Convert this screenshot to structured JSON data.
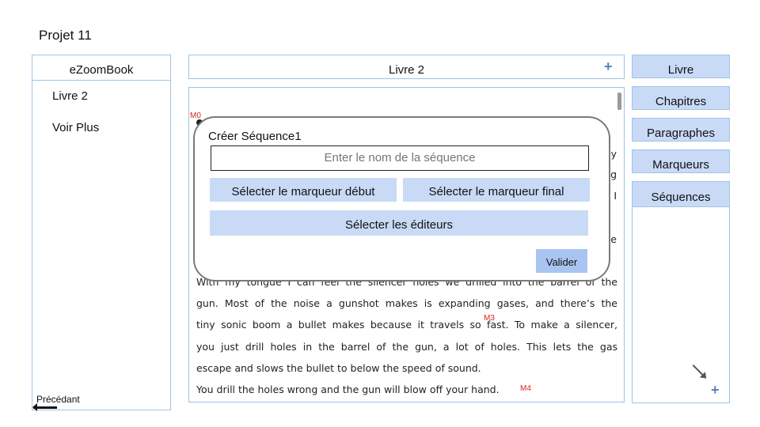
{
  "project_title": "Projet 11",
  "left_panel": {
    "title": "eZoomBook",
    "items": [
      {
        "label": "Livre 2"
      },
      {
        "label": "Voir Plus"
      }
    ],
    "previous_label": "Précédant"
  },
  "center": {
    "header_title": "Livre 2",
    "lines": [
      "With my tongue I can feel the silencer holes we drilled into the barrel of the",
      "gun. Most of the noise a gunshot makes is expanding gases, and there’s the",
      "tiny sonic boom a bullet makes because it travels so fast.  To make a silencer,",
      "you just drill holes in the barrel of the gun, a lot of holes. This lets the gas",
      "escape and slows the bullet to below the speed of sound.",
      "You drill the holes wrong and the gun will blow off your hand."
    ],
    "hidden_fragments": [
      "y",
      "g",
      "I",
      "e"
    ],
    "markers": {
      "m0": "M0",
      "m3": "M3",
      "m4": "M4"
    }
  },
  "right_panel": {
    "buttons": [
      {
        "label": "Livre"
      },
      {
        "label": "Chapitres"
      },
      {
        "label": "Paragraphes"
      },
      {
        "label": "Marqueurs"
      }
    ],
    "sequences_title": "Séquences"
  },
  "modal": {
    "title": "Créer Séquence1",
    "name_placeholder": "Enter le nom de la séquence",
    "start_marker_label": "Sélecter le marqueur début",
    "end_marker_label": "Sélecter le marqueur final",
    "editors_label": "Sélecter les éditeurs",
    "submit_label": "Valider"
  },
  "colors": {
    "panel_border": "#9ec4e6",
    "button_fill": "#c9daf7",
    "submit_fill": "#a9c4f0",
    "marker": "#e02020",
    "plus_icon": "#5b83b3"
  },
  "icons": [
    "plus-icon",
    "arrow-left-icon",
    "diagonal-arrow-icon",
    "scrollbar-thumb"
  ]
}
